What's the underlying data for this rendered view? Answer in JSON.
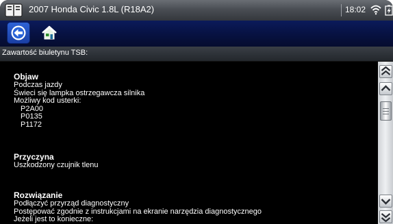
{
  "titlebar": {
    "title": "2007 Honda Civic 1.8L (R18A2)",
    "time": "18:02",
    "icons": [
      "book-icon",
      "wifi-icon",
      "battery-icon"
    ]
  },
  "toolbar": {
    "buttons": [
      "back-icon",
      "home-icon"
    ]
  },
  "section": {
    "title": "Zawartość biuletynu TSB:"
  },
  "content": {
    "symptom": {
      "heading": "Objaw",
      "lines": [
        "Podczas jazdy",
        "Świeci się lampka ostrzegawcza silnika",
        "Możliwy kod usterki:"
      ],
      "codes": [
        "P2A00",
        "P0135",
        "P1172"
      ]
    },
    "cause": {
      "heading": "Przyczyna",
      "lines": [
        "Uszkodzony czujnik tlenu"
      ]
    },
    "solution": {
      "heading": "Rozwiązanie",
      "lines": [
        "Podłączyć przyrząd diagnostyczny",
        "Postępować zgodnie z instrukcjami na ekranie narzędzia diagnostycznego",
        "Jeżeli jest to konieczne:"
      ]
    }
  },
  "colors": {
    "toolbar_bg": "#071243",
    "content_bg": "#000000",
    "text": "#ffffff"
  }
}
